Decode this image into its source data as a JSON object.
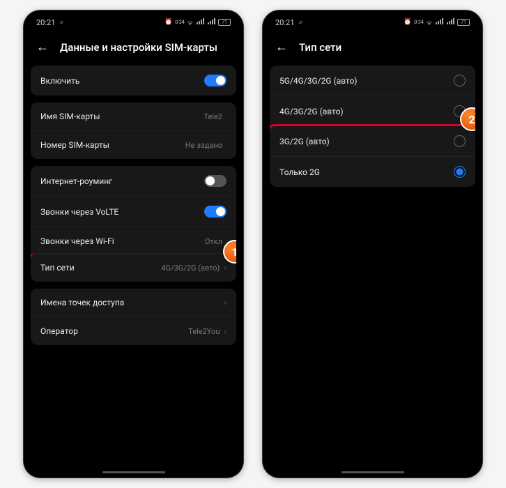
{
  "status": {
    "time": "20:21",
    "alarm_text": "0:34",
    "battery": "71"
  },
  "phone1": {
    "title": "Данные и настройки SIM-карты",
    "enable": {
      "label": "Включить"
    },
    "sim_name": {
      "label": "Имя SIM-карты",
      "value": "Tele2"
    },
    "sim_number": {
      "label": "Номер SIM-карты",
      "value": "Не задано"
    },
    "roaming": {
      "label": "Интернет-роуминг"
    },
    "volte": {
      "label": "Звонки через VoLTE"
    },
    "wifi_call": {
      "label": "Звонки через Wi-Fi",
      "value": "Откл"
    },
    "net_type": {
      "label": "Тип сети",
      "value": "4G/3G/2G (авто)"
    },
    "apn": {
      "label": "Имена точек доступа"
    },
    "operator": {
      "label": "Оператор",
      "value": "Tele2You"
    }
  },
  "phone2": {
    "title": "Тип сети",
    "options": {
      "opt1": "5G/4G/3G/2G (авто)",
      "opt2": "4G/3G/2G (авто)",
      "opt3": "3G/2G (авто)",
      "opt4": "Только 2G"
    }
  },
  "badges": {
    "b1": "1",
    "b2": "2"
  }
}
